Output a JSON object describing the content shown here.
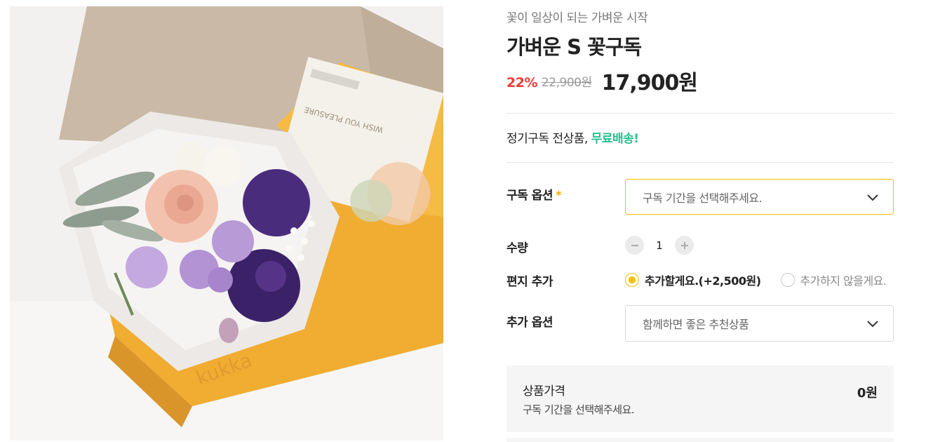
{
  "product": {
    "subtitle": "꽃이 일상이 되는 가벼운 시작",
    "title": "가벼운 S 꽃구독",
    "discount": "22%",
    "original_price": "22,900원",
    "sale_price": "17,900원"
  },
  "shipping": {
    "prefix": "정기구독 전상품, ",
    "highlight": "무료배송!"
  },
  "options": {
    "subscription_label": "구독 옵션",
    "required_mark": "*",
    "subscription_placeholder": "구독 기간을 선택해주세요.",
    "quantity_label": "수량",
    "quantity_value": "1",
    "letter_label": "편지 추가",
    "letter_add": "추가할게요.(+2,500원)",
    "letter_skip": "추가하지 않을게요.",
    "letter_selected": "add",
    "extra_label": "추가 옵션",
    "extra_placeholder": "함께하면 좋은 추천상품"
  },
  "summary": {
    "title": "상품가격",
    "sub": "구독 기간을 선택해주세요.",
    "price": "0원"
  },
  "image": {
    "card_text": "WISH YOU PLEASURE",
    "box_brand": "kukka"
  },
  "colors": {
    "accent": "#f5c000",
    "discount": "#f03b3b",
    "free_shipping": "#26c08f",
    "box": "#f2b43a"
  },
  "icons": {
    "select_arrow": "chevron-down-icon",
    "decrease": "minus-icon",
    "increase": "plus-icon"
  }
}
